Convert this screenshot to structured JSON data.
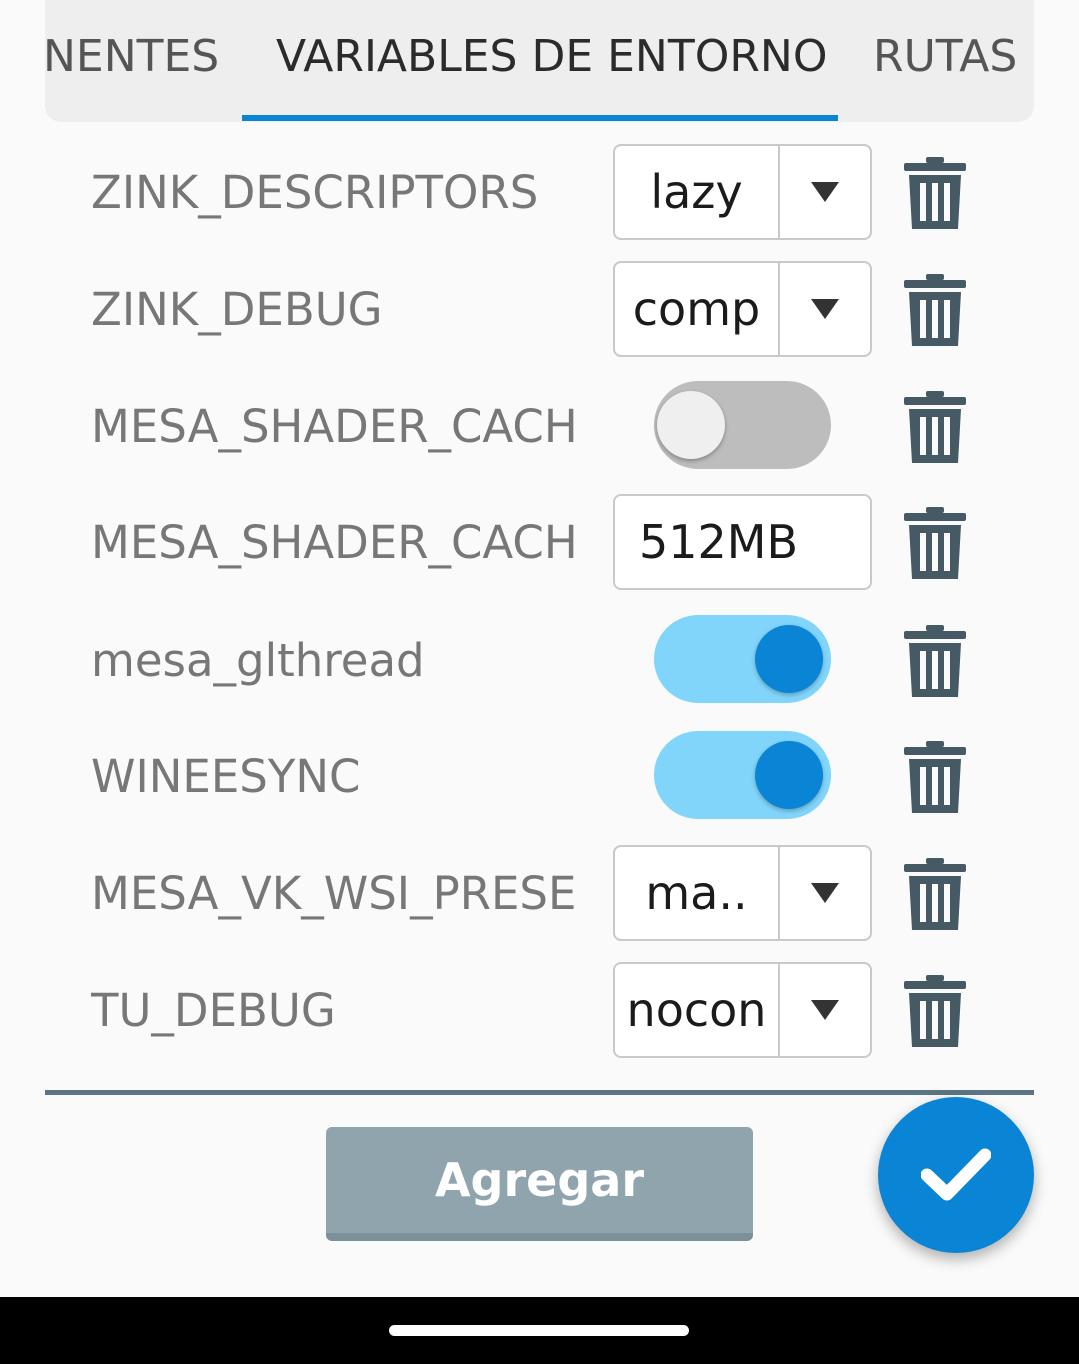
{
  "tabs": {
    "partial_label": "NENTES",
    "active_label": "VARIABLES DE ENTORNO",
    "next_label": "RUTAS"
  },
  "variables": [
    {
      "name": "ZINK_DESCRIPTORS",
      "control": "select",
      "value": "lazy"
    },
    {
      "name": "ZINK_DEBUG",
      "control": "select",
      "value": "comp"
    },
    {
      "name": "MESA_SHADER_CACH",
      "control": "switch",
      "checked": false
    },
    {
      "name": "MESA_SHADER_CACH",
      "control": "text",
      "value": "512MB"
    },
    {
      "name": "mesa_glthread",
      "control": "switch",
      "checked": true
    },
    {
      "name": "WINEESYNC",
      "control": "switch",
      "checked": true
    },
    {
      "name": "MESA_VK_WSI_PRESE",
      "control": "select",
      "value": "ma.."
    },
    {
      "name": "TU_DEBUG",
      "control": "select",
      "value": "nocon"
    }
  ],
  "add_button_label": "Agregar",
  "icons": {
    "delete": "trash-icon",
    "dropdown": "dropdown-arrow-icon",
    "confirm": "check-icon"
  },
  "colors": {
    "accent": "#0a84d4",
    "switch_track_on": "#81d4fa",
    "switch_track_off": "#bdbdbd",
    "add_button": "#90a4ae",
    "trash": "#455a64"
  }
}
